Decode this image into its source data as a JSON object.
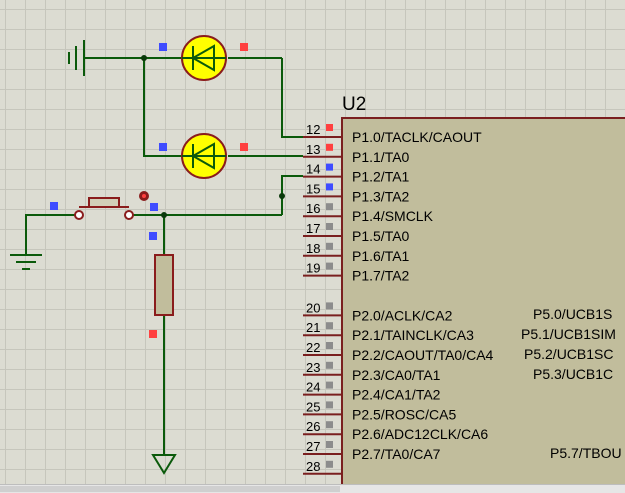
{
  "schematic": {
    "chip": {
      "ref": "U2",
      "colors": {
        "body": "#c1bd9c",
        "border": "#7a1f1f",
        "wire": "#004f00",
        "pin": "#7a1f1f"
      },
      "pins": [
        {
          "num": "12",
          "label": "P1.0/TACLK/CAOUT",
          "marker": "red"
        },
        {
          "num": "13",
          "label": "P1.1/TA0",
          "marker": "red"
        },
        {
          "num": "14",
          "label": "P1.2/TA1",
          "marker": "blue"
        },
        {
          "num": "15",
          "label": "P1.3/TA2",
          "marker": "blue"
        },
        {
          "num": "16",
          "label": "P1.4/SMCLK",
          "marker": "gray"
        },
        {
          "num": "17",
          "label": "P1.5/TA0",
          "marker": "gray"
        },
        {
          "num": "18",
          "label": "P1.6/TA1",
          "marker": "gray"
        },
        {
          "num": "19",
          "label": "P1.7/TA2",
          "marker": "gray"
        },
        {
          "num": "20",
          "label": "P2.0/ACLK/CA2",
          "marker": "gray"
        },
        {
          "num": "21",
          "label": "P2.1/TAINCLK/CA3",
          "marker": "gray"
        },
        {
          "num": "22",
          "label": "P2.2/CAOUT/TA0/CA4",
          "marker": "gray"
        },
        {
          "num": "23",
          "label": "P2.3/CA0/TA1",
          "marker": "gray"
        },
        {
          "num": "24",
          "label": "P2.4/CA1/TA2",
          "marker": "gray"
        },
        {
          "num": "25",
          "label": "P2.5/ROSC/CA5",
          "marker": "gray"
        },
        {
          "num": "26",
          "label": "P2.6/ADC12CLK/CA6",
          "marker": "gray"
        },
        {
          "num": "27",
          "label": "P2.7/TA0/CA7",
          "marker": "gray"
        },
        {
          "num": "28",
          "label": "",
          "marker": "gray"
        }
      ],
      "right_labels": [
        "P5.0/UCB1S",
        "P5.1/UCB1SIM",
        "P5.2/UCB1SC",
        "P5.3/UCB1C",
        "P5.7/TBOU"
      ]
    },
    "marker_colors": {
      "red": "#ff4040",
      "blue": "#3f4cff",
      "gray": "#8c8c8c"
    },
    "led_color": "#ffff00"
  }
}
